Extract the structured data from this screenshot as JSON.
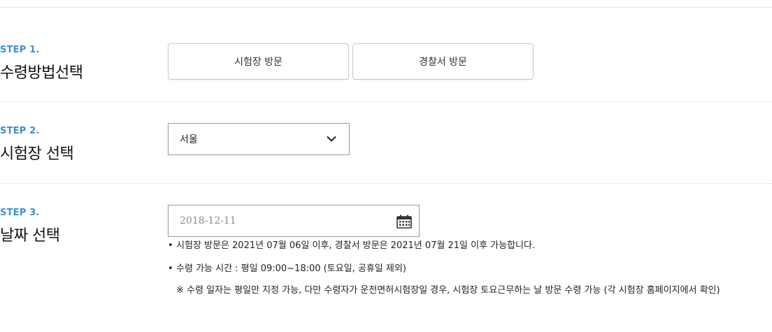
{
  "steps": [
    {
      "label": "STEP 1.",
      "title": "수령방법선택",
      "options": [
        "시험장 방문",
        "경찰서 방문"
      ]
    },
    {
      "label": "STEP 2.",
      "title": "시험장 선택",
      "selected_value": "서울"
    },
    {
      "label": "STEP 3.",
      "title": "날짜 선택",
      "date_value": "2018-12-11",
      "notes": [
        "시험장 방문은 2021년 07월 06일 이후, 경찰서 방문은 2021년 07월 21일 이후 가능합니다.",
        "수령 가능 시간 : 평일 09:00~18:00 (토요일, 공휴일 제외)"
      ],
      "sub_note": "※ 수령 일자는 평일만 지정 가능, 다만 수령자가 운전면허시험장일 경우, 시험장 토요근무하는 날 방문 수령 가능 (각 시험장 홈페이지에서 확인)"
    }
  ],
  "icons": {
    "select_arrow": "chevron-down-icon",
    "date_picker": "calendar-icon"
  }
}
